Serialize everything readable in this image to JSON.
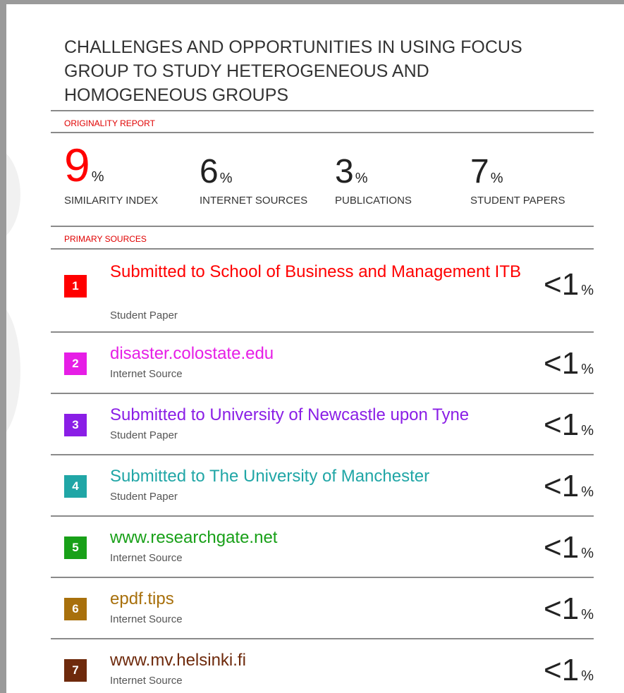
{
  "report": {
    "title": "CHALLENGES AND OPPORTUNITIES IN USING FOCUS GROUP TO STUDY HETEROGENEOUS AND HOMOGENEOUS GROUPS",
    "originality_label": "ORIGINALITY REPORT",
    "primary_sources_label": "PRIMARY SOURCES"
  },
  "stats": {
    "similarity": {
      "value": "9",
      "unit": "%",
      "label": "SIMILARITY INDEX"
    },
    "internet": {
      "value": "6",
      "unit": "%",
      "label": "INTERNET SOURCES"
    },
    "publications": {
      "value": "3",
      "unit": "%",
      "label": "PUBLICATIONS"
    },
    "student": {
      "value": "7",
      "unit": "%",
      "label": "STUDENT PAPERS"
    }
  },
  "sources": [
    {
      "rank": "1",
      "title": "Submitted to School of Business and Management ITB",
      "type": "Student Paper",
      "percent": "<1",
      "unit": "%",
      "color": "#ff0000"
    },
    {
      "rank": "2",
      "title": "disaster.colostate.edu",
      "type": "Internet Source",
      "percent": "<1",
      "unit": "%",
      "color": "#e61ee6"
    },
    {
      "rank": "3",
      "title": "Submitted to University of Newcastle upon Tyne",
      "type": "Student Paper",
      "percent": "<1",
      "unit": "%",
      "color": "#8a1ee6"
    },
    {
      "rank": "4",
      "title": "Submitted to The University of Manchester",
      "type": "Student Paper",
      "percent": "<1",
      "unit": "%",
      "color": "#20a6a6"
    },
    {
      "rank": "5",
      "title": "www.researchgate.net",
      "type": "Internet Source",
      "percent": "<1",
      "unit": "%",
      "color": "#18a018"
    },
    {
      "rank": "6",
      "title": "epdf.tips",
      "type": "Internet Source",
      "percent": "<1",
      "unit": "%",
      "color": "#a8700c"
    },
    {
      "rank": "7",
      "title": "www.mv.helsinki.fi",
      "type": "Internet Source",
      "percent": "<1",
      "unit": "%",
      "color": "#6e2a0c"
    }
  ]
}
